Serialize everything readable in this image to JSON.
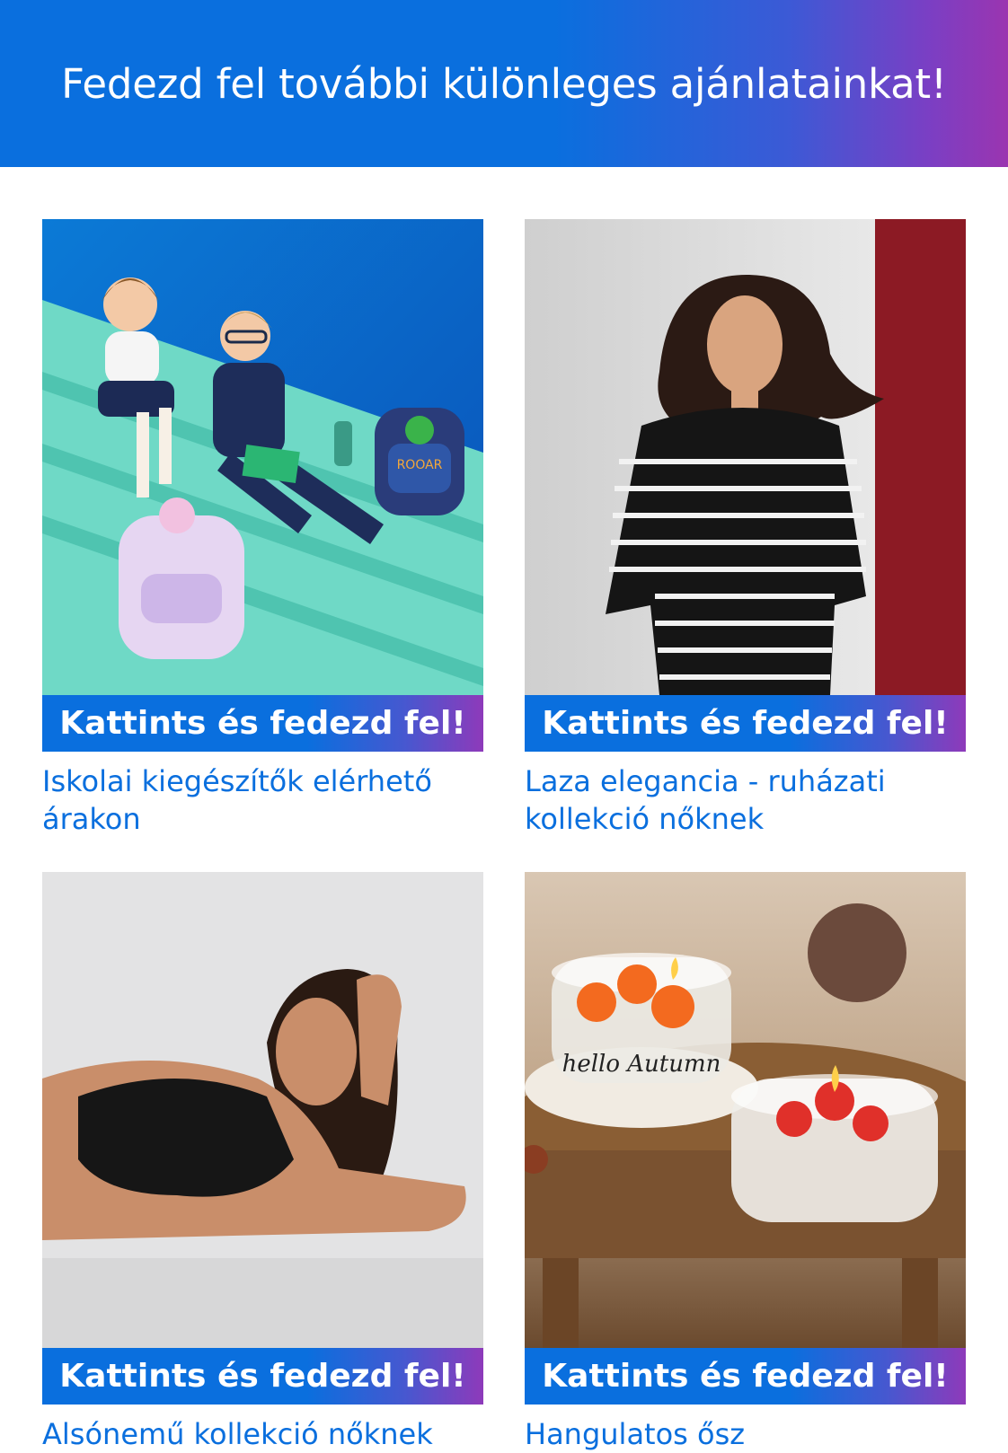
{
  "banner": {
    "title": "Fedezd fel további különleges ajánlatainkat!"
  },
  "cards": [
    {
      "image": "children-with-school-backpacks-photo",
      "image_text": "ROOAR",
      "cta": "Kattints és fedezd fel!",
      "caption": "Iskolai kiegészítők elérhető árakon"
    },
    {
      "image": "woman-striped-sweater-photo",
      "cta": "Kattints és fedezd fel!",
      "caption": "Laza elegancia - ruházati kollekció nőknek"
    },
    {
      "image": "woman-lingerie-photo",
      "cta": "Kattints és fedezd fel!",
      "caption": "Alsónemű kollekció nőknek"
    },
    {
      "image": "autumn-candles-photo",
      "image_text": "hello Autumn",
      "cta": "Kattints és fedezd fel!",
      "caption": "Hangulatos ősz"
    }
  ],
  "colors": {
    "brand_blue": "#0a6fde",
    "accent_purple": "#9b35b0"
  }
}
